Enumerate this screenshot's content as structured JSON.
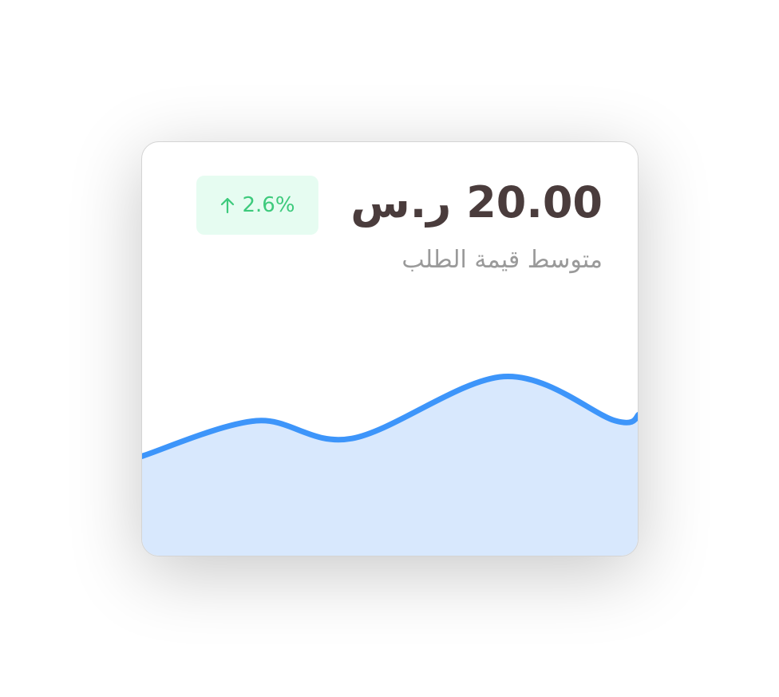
{
  "card": {
    "value": "20.00 ر.س",
    "change": "2.6%",
    "change_direction": "up",
    "label": "متوسط قيمة الطلب",
    "colors": {
      "line": "#3d95fa",
      "fill": "#d8e8fd",
      "badge_bg": "#e6fcf1",
      "badge_text": "#3dca7c",
      "value": "#4a3c3c"
    }
  },
  "chart_data": {
    "type": "area",
    "x": [
      0,
      1,
      2,
      3,
      4,
      5
    ],
    "values": [
      45,
      61,
      53,
      81,
      61,
      64
    ],
    "ylim": [
      0,
      100
    ],
    "title": "",
    "xlabel": "",
    "ylabel": ""
  }
}
